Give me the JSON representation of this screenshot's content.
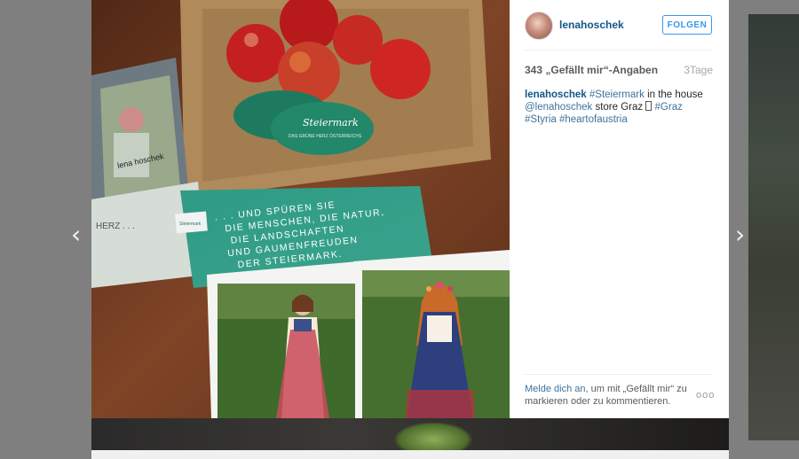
{
  "post": {
    "username": "lenahoschek",
    "follow_label": "FOLGEN",
    "likes": "343 „Gefällt mir“-Angaben",
    "time_ago": "3Tage",
    "caption": {
      "user": "lenahoschek",
      "tag1": "#Steiermark",
      "text1": " in the house ",
      "mention": "@lenahoschek",
      "text2": " store Graz ",
      "tag2": "#Graz",
      "tag3": "#Styria",
      "tag4": "#heartofaustria"
    },
    "login": {
      "link": "Melde dich an",
      "text": ", um mit „Gefällt mir“ zu markieren oder zu kommentieren."
    },
    "more_label": "ooo"
  },
  "photo": {
    "card_brand": "Steiermark",
    "card_sub": "DAS GRÜNE HERZ ÖSTERREICHS",
    "booklet_line1": ". . . UND SPÜREN SIE",
    "booklet_line2": "DIE MENSCHEN, DIE NATUR,",
    "booklet_line3": "DIE LANDSCHAFTEN",
    "booklet_line4": "UND GAUMENFREUDEN",
    "booklet_line5": "DER STEIERMARK.",
    "left_book_title": "lena hoschek",
    "left_book_sub": "HERZ . . .",
    "stamp": "Steiermark"
  },
  "nav": {
    "prev_icon": "‹",
    "next_icon": "›"
  }
}
